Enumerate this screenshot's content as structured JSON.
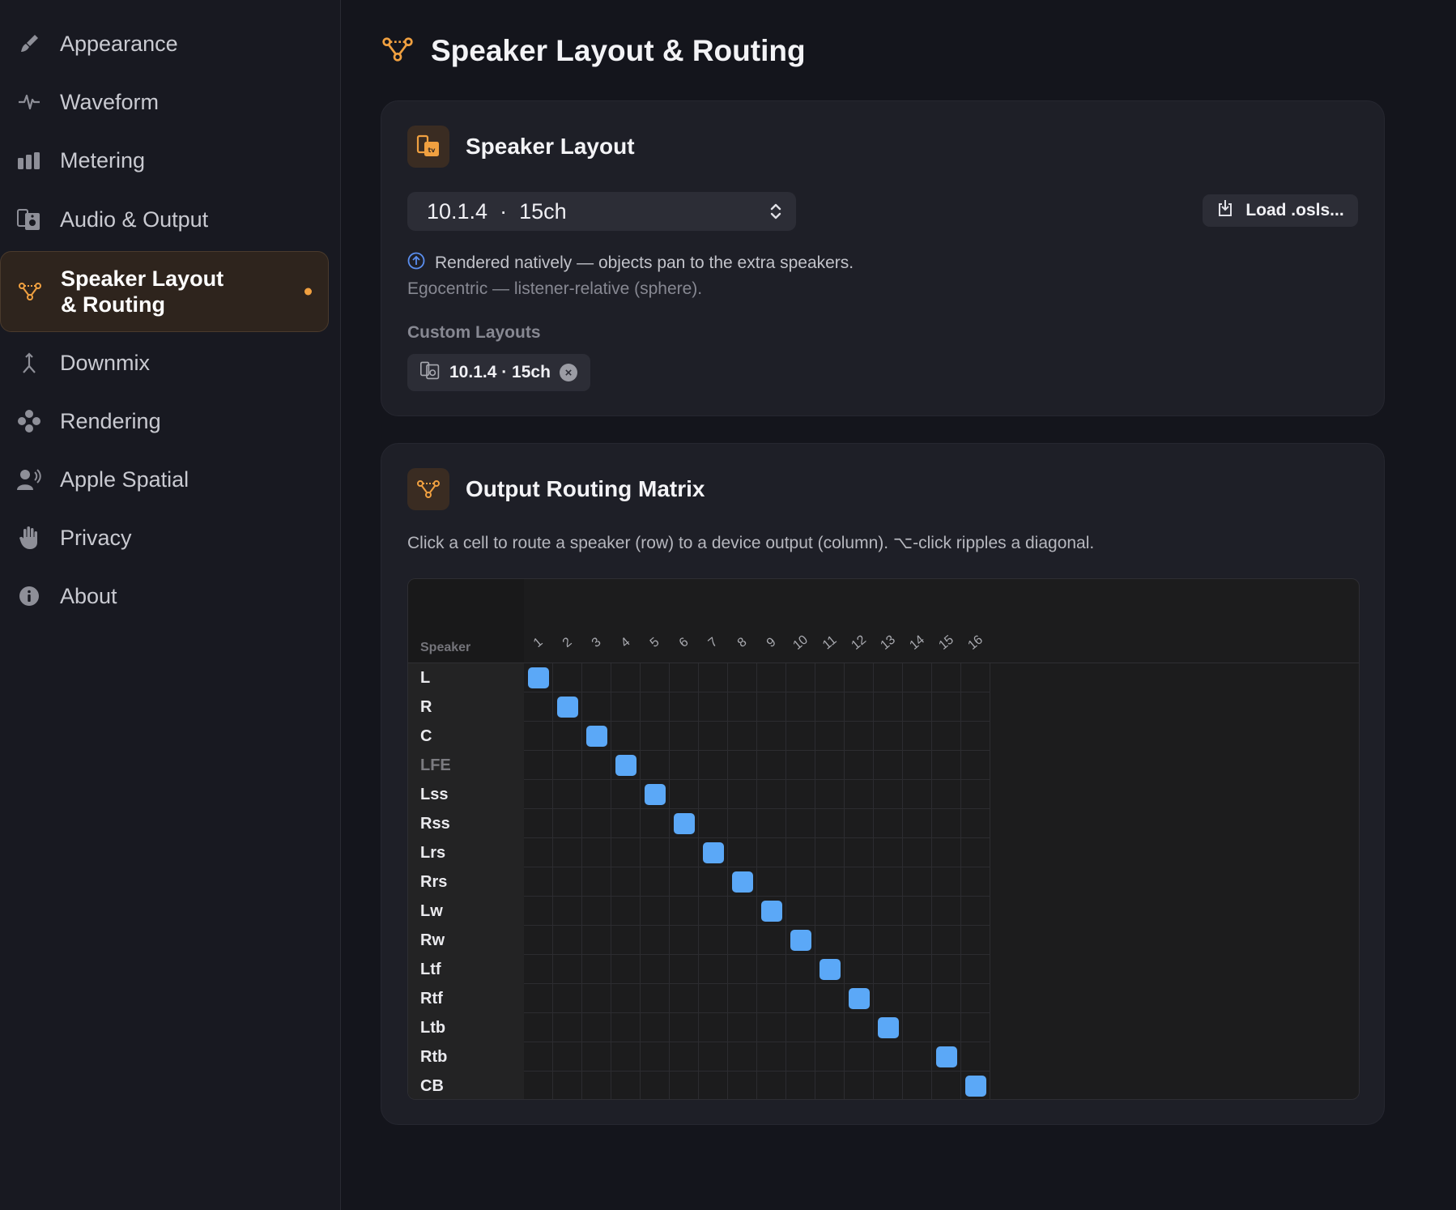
{
  "sidebar": {
    "items": [
      {
        "label": "Appearance",
        "icon": "paintbrush-icon"
      },
      {
        "label": "Waveform",
        "icon": "waveform-icon"
      },
      {
        "label": "Metering",
        "icon": "meter-bars-icon"
      },
      {
        "label": "Audio & Output",
        "icon": "speaker-output-icon"
      },
      {
        "label": "Speaker Layout\n& Routing",
        "icon": "routing-nodes-icon",
        "active": true
      },
      {
        "label": "Downmix",
        "icon": "downmix-arrow-icon"
      },
      {
        "label": "Rendering",
        "icon": "rendering-dots-icon"
      },
      {
        "label": "Apple Spatial",
        "icon": "person-wave-icon"
      },
      {
        "label": "Privacy",
        "icon": "hand-icon"
      },
      {
        "label": "About",
        "icon": "info-icon"
      }
    ]
  },
  "page": {
    "title": "Speaker Layout & Routing"
  },
  "layout_card": {
    "title": "Speaker Layout",
    "selected_layout": "10.1.4  ·  15ch",
    "load_button": "Load .osls...",
    "info_text": "Rendered natively — objects pan to the extra speakers.",
    "ego_text": "Egocentric — listener-relative (sphere).",
    "custom_label": "Custom Layouts",
    "custom_chip": "10.1.4 · 15ch"
  },
  "routing_card": {
    "title": "Output Routing Matrix",
    "description": "Click a cell to route a speaker (row) to a device output (column). ⌥-click ripples a diagonal.",
    "speaker_header": "Speaker",
    "columns": [
      "1",
      "2",
      "3",
      "4",
      "5",
      "6",
      "7",
      "8",
      "9",
      "10",
      "11",
      "12",
      "13",
      "14",
      "15",
      "16"
    ],
    "rows": [
      {
        "name": "L",
        "output": 1
      },
      {
        "name": "R",
        "output": 2
      },
      {
        "name": "C",
        "output": 3
      },
      {
        "name": "LFE",
        "output": 4,
        "dim": true
      },
      {
        "name": "Lss",
        "output": 5
      },
      {
        "name": "Rss",
        "output": 6
      },
      {
        "name": "Lrs",
        "output": 7
      },
      {
        "name": "Rrs",
        "output": 8
      },
      {
        "name": "Lw",
        "output": 9
      },
      {
        "name": "Rw",
        "output": 10
      },
      {
        "name": "Ltf",
        "output": 11
      },
      {
        "name": "Rtf",
        "output": 12
      },
      {
        "name": "Ltb",
        "output": 13
      },
      {
        "name": "Rtb",
        "output": 15
      },
      {
        "name": "CB",
        "output": 16
      }
    ]
  },
  "colors": {
    "accent": "#f0a040",
    "routed": "#5ba8f7"
  }
}
